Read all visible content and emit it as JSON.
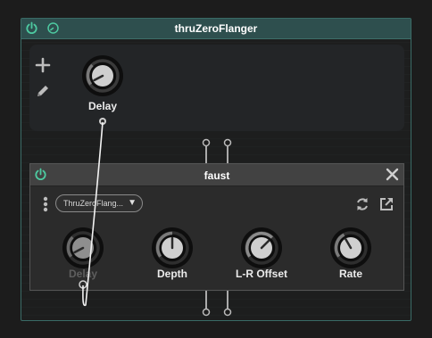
{
  "outer_window": {
    "title": "thruZeroFlanger",
    "power_icon": "power-icon",
    "gauge_icon": "gauge-icon"
  },
  "host_panel": {
    "add_icon": "plus-icon",
    "edit_icon": "pencil-icon",
    "knob": {
      "label": "Delay",
      "value": 0.35
    }
  },
  "inner_window": {
    "title": "faust",
    "power_icon": "power-icon",
    "close_icon": "close-icon",
    "menu_icon": "vertical-dots-icon",
    "preset": {
      "selected": "ThruZeroFlang..."
    },
    "refresh_icon": "refresh-icon",
    "open_external_icon": "open-external-icon",
    "knobs": [
      {
        "label": "Delay",
        "value": 0.35,
        "mapped": true
      },
      {
        "label": "Depth",
        "value": 0.5,
        "mapped": false
      },
      {
        "label": "L-R Offset",
        "value": 0.75,
        "mapped": false
      },
      {
        "label": "Rate",
        "value": 0.42,
        "mapped": false
      }
    ]
  },
  "colors": {
    "accent_teal": "#3a6b66",
    "power_green": "#4dc9a0",
    "knob_fill": "#cfcfcf"
  }
}
